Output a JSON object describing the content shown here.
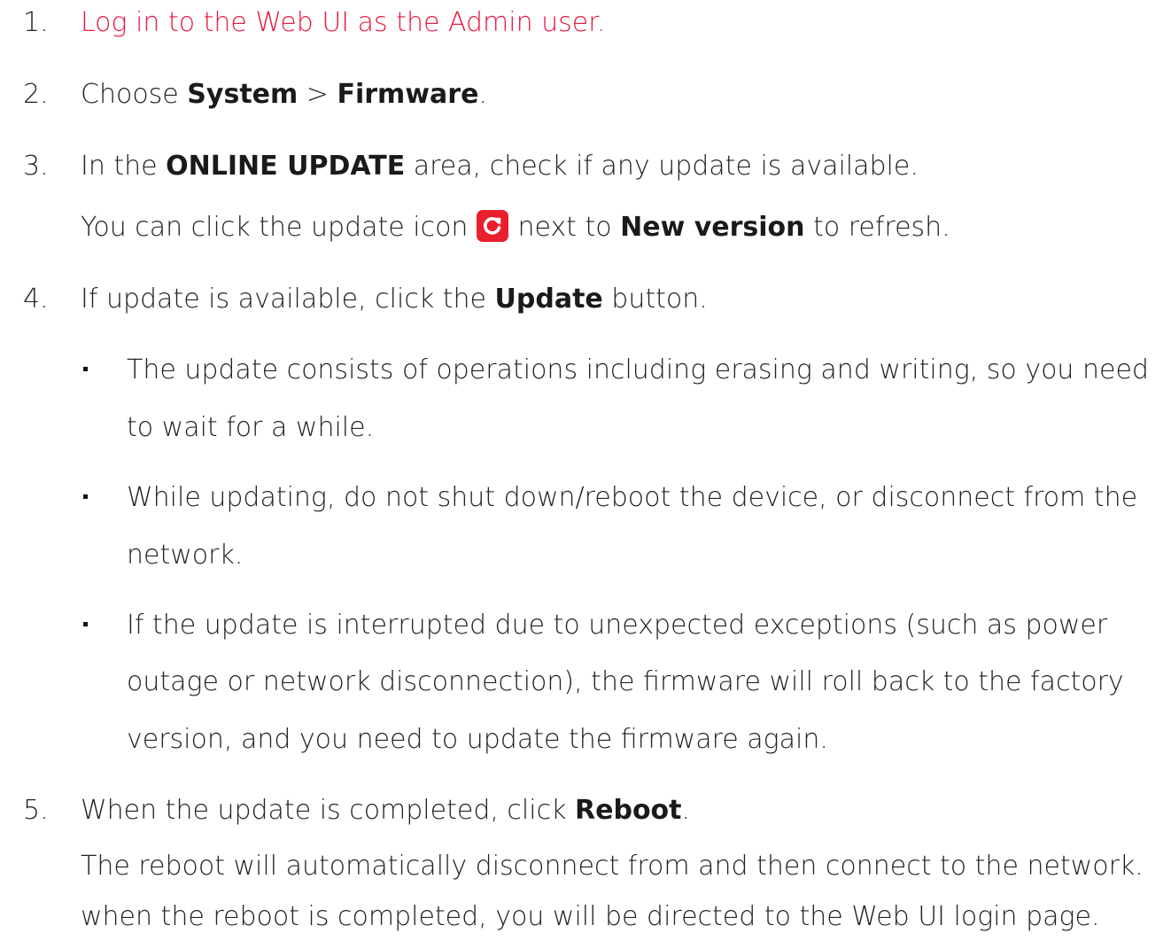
{
  "steps": [
    {
      "number": "1.",
      "link_text": "Log in to the Web UI as the Admin user."
    },
    {
      "number": "2.",
      "pre": "Choose ",
      "b1": "System",
      "sep": " > ",
      "b2": "Firmware",
      "post": "."
    },
    {
      "number": "3.",
      "pre": "In the ",
      "b1": "ONLINE UPDATE",
      "post": " area, check if any update is available.",
      "line2_pre": "You can click the update icon",
      "line2_mid": "next to ",
      "line2_bold": "New version",
      "line2_post": " to refresh."
    },
    {
      "number": "4.",
      "pre": "If update is available, click the ",
      "b1": "Update",
      "post": " button.",
      "bullets": [
        {
          "lines": [
            "The update consists of operations including erasing and writing, so you need",
            "to wait for a while."
          ]
        },
        {
          "lines": [
            "While updating, do not shut down/reboot the device, or disconnect from the",
            "network."
          ]
        },
        {
          "lines": [
            "If the update is interrupted due to unexpected exceptions (such as power",
            "outage or network disconnection), the firmware will roll back to the factory",
            "version, and you need to update the firmware again."
          ]
        }
      ]
    },
    {
      "number": "5.",
      "pre": "When the update is completed, click ",
      "b1": "Reboot",
      "post": ".",
      "line2": "The reboot will automatically disconnect from and then connect to the network.",
      "line3": "when the reboot is completed, you will be directed to the Web UI login page."
    }
  ],
  "icons": {
    "refresh": "refresh-icon"
  },
  "colors": {
    "link": "#e8193e",
    "icon_bg": "#ea1f2d",
    "text": "#222222"
  }
}
